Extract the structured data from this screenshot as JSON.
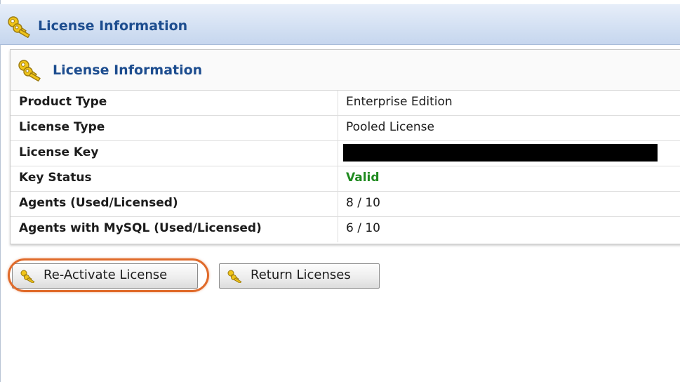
{
  "panel": {
    "title": "License Information",
    "icon": "key-icon"
  },
  "card": {
    "title": "License Information",
    "icon": "key-icon",
    "rows": [
      {
        "label": "Product Type",
        "value": "Enterprise Edition"
      },
      {
        "label": "License Type",
        "value": "Pooled License"
      },
      {
        "label": "License Key",
        "value": ""
      },
      {
        "label": "Key Status",
        "value": "Valid"
      },
      {
        "label": "Agents (Used/Licensed)",
        "value": "8 / 10"
      },
      {
        "label": "Agents with MySQL (Used/Licensed)",
        "value": "6 / 10"
      }
    ]
  },
  "buttons": {
    "reactivate_label": "Re-Activate License",
    "return_label": "Return Licenses"
  },
  "colors": {
    "title_blue": "#1d4d8f",
    "valid_green": "#1f8a1f",
    "highlight_orange": "#e06a2a"
  }
}
